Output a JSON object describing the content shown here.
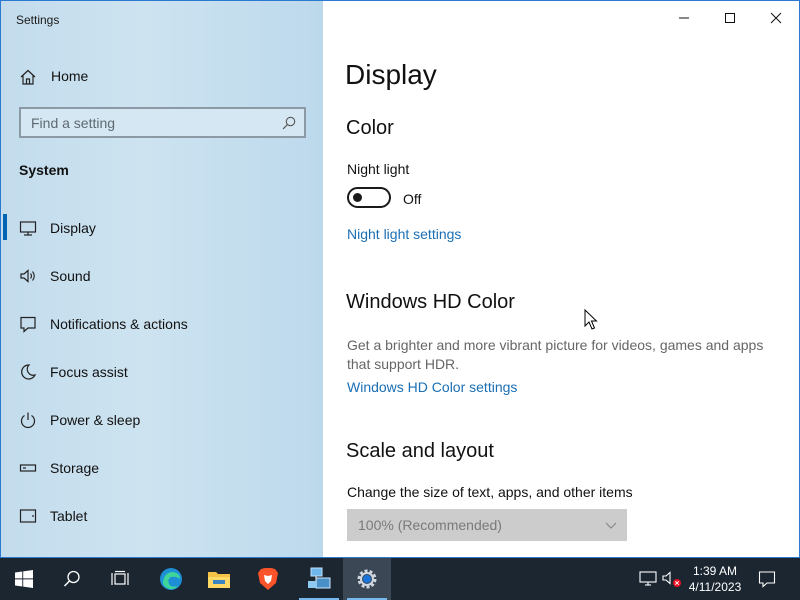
{
  "window": {
    "app_title": "Settings",
    "controls": [
      "minimize",
      "maximize",
      "close"
    ]
  },
  "sidebar": {
    "home_label": "Home",
    "search_placeholder": "Find a setting",
    "section_title": "System",
    "items": [
      {
        "label": "Display",
        "icon": "monitor-icon",
        "active": true
      },
      {
        "label": "Sound",
        "icon": "speaker-icon"
      },
      {
        "label": "Notifications & actions",
        "icon": "notification-icon"
      },
      {
        "label": "Focus assist",
        "icon": "moon-icon"
      },
      {
        "label": "Power & sleep",
        "icon": "power-icon"
      },
      {
        "label": "Storage",
        "icon": "storage-icon"
      },
      {
        "label": "Tablet",
        "icon": "tablet-icon"
      }
    ]
  },
  "main": {
    "page_title": "Display",
    "color": {
      "heading": "Color",
      "night_light_label": "Night light",
      "toggle_state": "Off",
      "night_light_settings_link": "Night light settings"
    },
    "hd_color": {
      "heading": "Windows HD Color",
      "description": "Get a brighter and more vibrant picture for videos, games and apps that support HDR.",
      "settings_link": "Windows HD Color settings"
    },
    "scale": {
      "heading": "Scale and layout",
      "label": "Change the size of text, apps, and other items",
      "dropdown_value": "100% (Recommended)"
    }
  },
  "taskbar": {
    "apps": [
      "start-icon",
      "search-icon",
      "task-view-icon",
      "edge-icon",
      "file-explorer-icon",
      "brave-icon",
      "network-app-icon",
      "settings-gear-icon"
    ],
    "time": "1:39 AM",
    "date": "4/11/2023"
  },
  "colors": {
    "accent": "#0063b1",
    "link": "#1a6fb5",
    "taskbar": "#1b2631"
  }
}
